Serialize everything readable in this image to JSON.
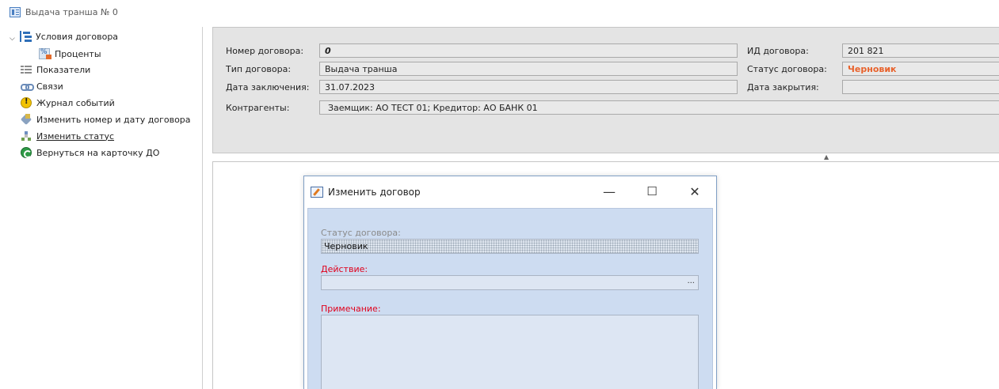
{
  "window": {
    "title": "Выдача транша № 0"
  },
  "sidebar": {
    "items": [
      {
        "label": "Условия договора",
        "icon": "tree-icon"
      },
      {
        "label": "Проценты",
        "icon": "percent-icon"
      },
      {
        "label": "Показатели",
        "icon": "indicators-icon"
      },
      {
        "label": "Связи",
        "icon": "links-icon"
      },
      {
        "label": "Журнал событий",
        "icon": "warning-icon"
      },
      {
        "label": "Изменить номер и дату  договора",
        "icon": "edit-icon"
      },
      {
        "label": "Изменить статус",
        "icon": "status-icon"
      },
      {
        "label": "Вернуться на карточку ДО",
        "icon": "back-icon"
      }
    ]
  },
  "details": {
    "contract_number_label": "Номер договора:",
    "contract_number": "0",
    "contract_type_label": "Тип договора:",
    "contract_type": "Выдача транша",
    "conclusion_date_label": "Дата заключения:",
    "conclusion_date": "31.07.2023",
    "counterparties_label": "Контрагенты:",
    "counterparties": "Заемщик: АО ТЕСТ 01; Кредитор: АО БАНК 01",
    "contract_id_label": "ИД договора:",
    "contract_id": "201 821",
    "contract_status_label": "Статус договора:",
    "contract_status": "Черновик",
    "close_date_label": "Дата закрытия:",
    "close_date": ""
  },
  "dialog": {
    "title": "Изменить договор",
    "minimize": "—",
    "maximize": "☐",
    "close": "✕",
    "status_label": "Статус договора:",
    "status_value": "Черновик",
    "action_label": "Действие:",
    "action_value": "",
    "action_button": "...",
    "note_label": "Примечание:",
    "note_value": ""
  },
  "colors": {
    "status_accent": "#e8622c",
    "required_label": "#e0001b",
    "dialog_background": "#cddcf1"
  }
}
